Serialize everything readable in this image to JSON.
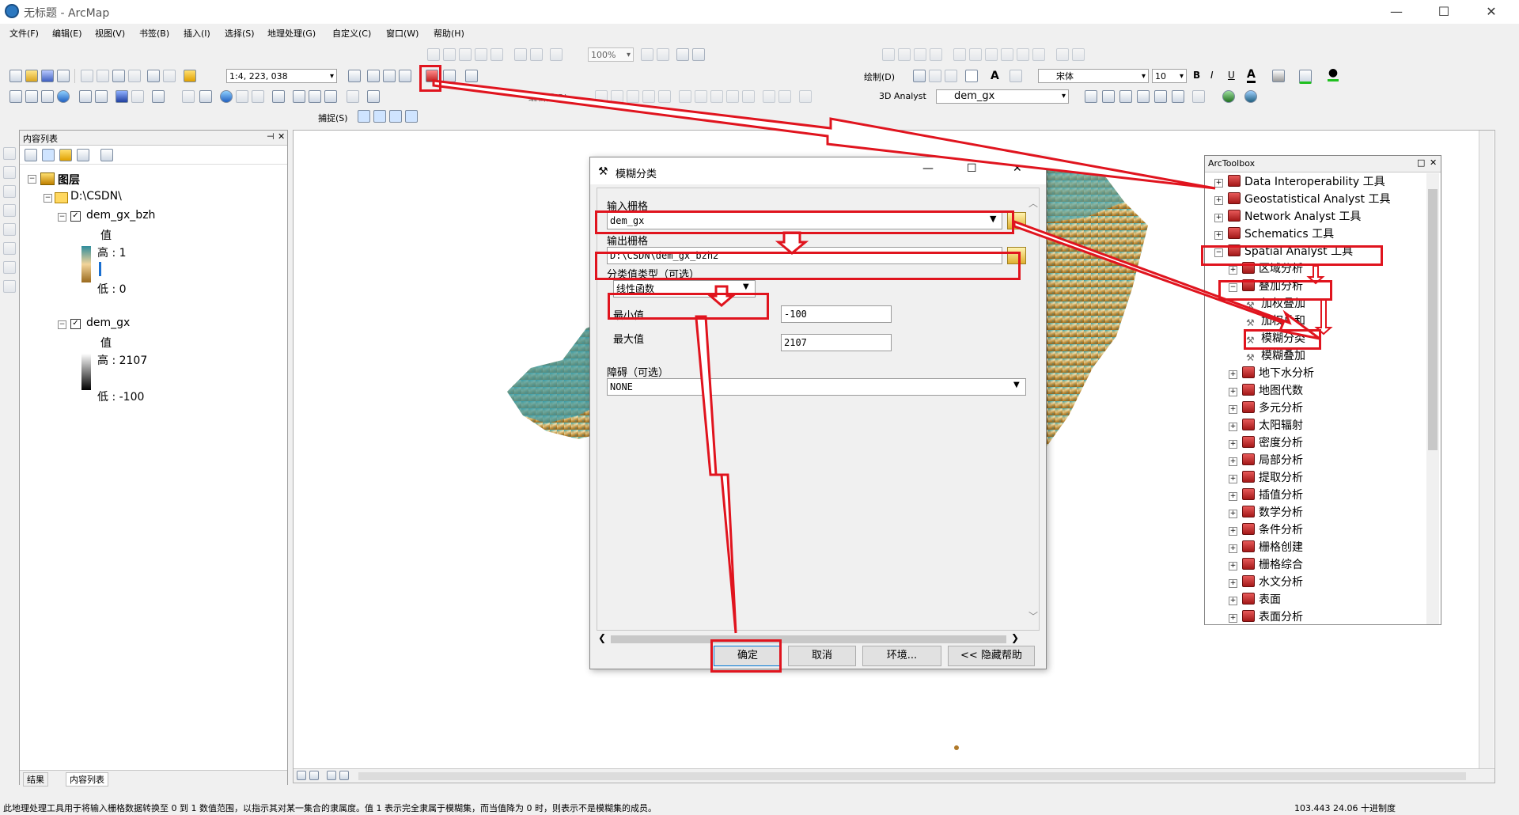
{
  "window": {
    "title": "无标题 - ArcMap",
    "min": "—",
    "max": "☐",
    "close": "✕"
  },
  "menu": [
    "文件(F)",
    "编辑(E)",
    "视图(V)",
    "书签(B)",
    "插入(I)",
    "选择(S)",
    "地理处理(G)",
    "自定义(C)",
    "窗口(W)",
    "帮助(H)"
  ],
  "toolbar": {
    "scale": "1:4, 223, 038",
    "zoom_pct": "100%",
    "draw_label": "绘制(D)",
    "font": "宋体",
    "font_size": "10",
    "bold": "B",
    "italic": "I",
    "underline": "U",
    "editor_label": "编辑器(R)",
    "analyst_label": "3D Analyst",
    "layer_combo": "dem_gx",
    "snap_label": "捕捉(S)"
  },
  "toc": {
    "title": "内容列表",
    "pin": "ᵖ",
    "close": "✕",
    "root": "图层",
    "folder": "D:\\CSDN\\",
    "layers": [
      {
        "name": "dem_gx_bzh",
        "value_label": "值",
        "high": "高 : 1",
        "low": "低 : 0"
      },
      {
        "name": "dem_gx",
        "value_label": "值",
        "high": "高 : 2107",
        "low": "低 : -100"
      }
    ],
    "tabs": [
      "结果",
      "内容列表"
    ]
  },
  "dialog": {
    "title": "模糊分类",
    "input_raster_label": "输入栅格",
    "input_raster_value": "dem_gx",
    "output_raster_label": "输出栅格",
    "output_raster_value": "D:\\CSDN\\dem_gx_bzh2",
    "membership_label": "分类值类型（可选）",
    "membership_value": "线性函数",
    "min_label": "最小值",
    "min_value": "-100",
    "max_label": "最大值",
    "max_value": "2107",
    "hedge_label": "障碍（可选）",
    "hedge_value": "NONE",
    "ok": "确定",
    "cancel": "取消",
    "env": "环境...",
    "help": "<< 隐藏帮助"
  },
  "toolbox": {
    "title": "ArcToolbox",
    "items": [
      {
        "label": "Data Interoperability 工具",
        "level": 0,
        "exp": "+"
      },
      {
        "label": "Geostatistical Analyst 工具",
        "level": 0,
        "exp": "+"
      },
      {
        "label": "Network Analyst 工具",
        "level": 0,
        "exp": "+"
      },
      {
        "label": "Schematics 工具",
        "level": 0,
        "exp": "+"
      },
      {
        "label": "Spatial Analyst 工具",
        "level": 0,
        "exp": "−"
      },
      {
        "label": "区域分析",
        "level": 1,
        "exp": "+"
      },
      {
        "label": "叠加分析",
        "level": 1,
        "exp": "−"
      },
      {
        "label": "加权叠加",
        "level": 2,
        "exp": ""
      },
      {
        "label": "加权总和",
        "level": 2,
        "exp": ""
      },
      {
        "label": "模糊分类",
        "level": 2,
        "exp": ""
      },
      {
        "label": "模糊叠加",
        "level": 2,
        "exp": ""
      },
      {
        "label": "地下水分析",
        "level": 1,
        "exp": "+"
      },
      {
        "label": "地图代数",
        "level": 1,
        "exp": "+"
      },
      {
        "label": "多元分析",
        "level": 1,
        "exp": "+"
      },
      {
        "label": "太阳辐射",
        "level": 1,
        "exp": "+"
      },
      {
        "label": "密度分析",
        "level": 1,
        "exp": "+"
      },
      {
        "label": "局部分析",
        "level": 1,
        "exp": "+"
      },
      {
        "label": "提取分析",
        "level": 1,
        "exp": "+"
      },
      {
        "label": "插值分析",
        "level": 1,
        "exp": "+"
      },
      {
        "label": "数学分析",
        "level": 1,
        "exp": "+"
      },
      {
        "label": "条件分析",
        "level": 1,
        "exp": "+"
      },
      {
        "label": "栅格创建",
        "level": 1,
        "exp": "+"
      },
      {
        "label": "栅格综合",
        "level": 1,
        "exp": "+"
      },
      {
        "label": "水文分析",
        "level": 1,
        "exp": "+"
      },
      {
        "label": "表面",
        "level": 1,
        "exp": "+"
      },
      {
        "label": "表面分析",
        "level": 1,
        "exp": "+"
      }
    ]
  },
  "status": {
    "message": "此地理处理工具用于将输入栅格数据转换至 0 到 1 数值范围，以指示其对某一集合的隶属度。值 1 表示完全隶属于模糊集，而当值降为 0 时，则表示不是模糊集的成员。",
    "coords": "103.443  24.06 十进制度"
  },
  "colors": {
    "annotation": "#e0141e",
    "dem_high": "#2f8d9c",
    "dem_low": "#9a6a1e"
  }
}
